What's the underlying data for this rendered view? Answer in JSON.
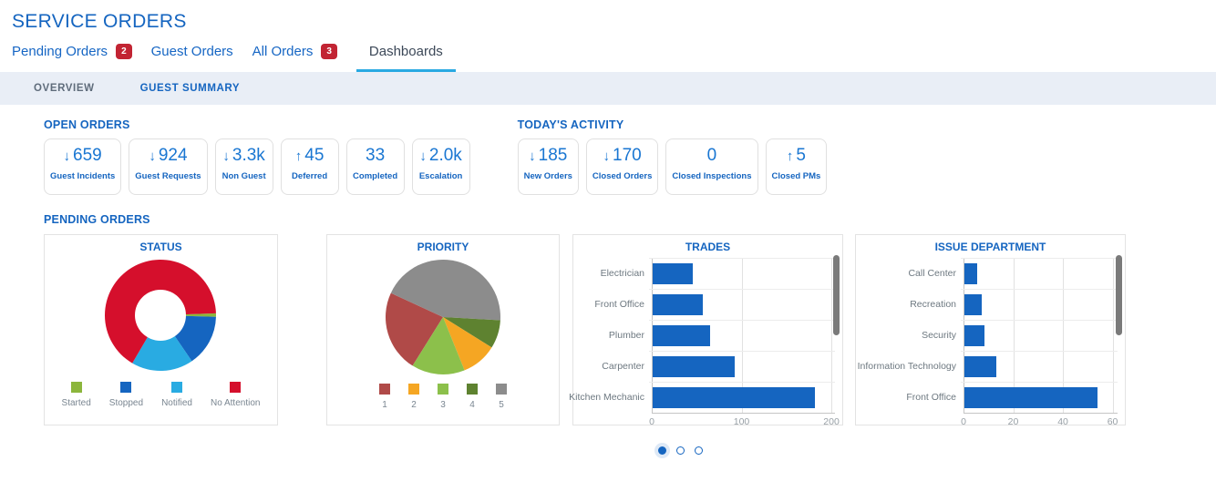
{
  "page": {
    "title": "SERVICE ORDERS"
  },
  "tabs": [
    {
      "label": "Pending Orders",
      "badge": "2",
      "active": false
    },
    {
      "label": "Guest Orders",
      "badge": null,
      "active": false
    },
    {
      "label": "All Orders",
      "badge": "3",
      "active": false
    },
    {
      "label": "Dashboards",
      "badge": null,
      "active": true
    }
  ],
  "subnav": [
    {
      "label": "OVERVIEW",
      "highlighted": false
    },
    {
      "label": "GUEST SUMMARY",
      "highlighted": true
    }
  ],
  "icons": {
    "down": "↓",
    "up": "↑"
  },
  "sections": {
    "open_orders": {
      "title": "OPEN ORDERS",
      "cards": [
        {
          "value": "659",
          "trend": "down",
          "label": "Guest Incidents"
        },
        {
          "value": "924",
          "trend": "down",
          "label": "Guest Requests"
        },
        {
          "value": "3.3k",
          "trend": "down",
          "label": "Non Guest"
        },
        {
          "value": "45",
          "trend": "up",
          "label": "Deferred"
        },
        {
          "value": "33",
          "trend": null,
          "label": "Completed"
        },
        {
          "value": "2.0k",
          "trend": "down",
          "label": "Escalation"
        }
      ]
    },
    "todays_activity": {
      "title": "TODAY'S ACTIVITY",
      "cards": [
        {
          "value": "185",
          "trend": "down",
          "label": "New Orders"
        },
        {
          "value": "170",
          "trend": "down",
          "label": "Closed Orders"
        },
        {
          "value": "0",
          "trend": null,
          "label": "Closed Inspections"
        },
        {
          "value": "5",
          "trend": "up",
          "label": "Closed PMs"
        }
      ]
    },
    "pending_orders": {
      "title": "PENDING ORDERS"
    }
  },
  "chart_data": [
    {
      "id": "status",
      "type": "donut",
      "title": "STATUS",
      "labels": [
        "Started",
        "Stopped",
        "Notified",
        "No Attention"
      ],
      "values": [
        1,
        15,
        18,
        66
      ],
      "colors": [
        "#8cb63c",
        "#1565c0",
        "#29abe2",
        "#d50f2c"
      ],
      "start_angle": 88,
      "draw_order": [
        0,
        1,
        2,
        3
      ],
      "inner_radius_ratio": 0.46,
      "legend_position": "bottom"
    },
    {
      "id": "priority",
      "type": "pie",
      "title": "PRIORITY",
      "labels": [
        "1",
        "2",
        "3",
        "4",
        "5"
      ],
      "values": [
        23,
        10,
        15,
        8,
        44
      ],
      "colors": [
        "#b04a48",
        "#f5a623",
        "#8cc04b",
        "#5e8230",
        "#8c8c8c"
      ],
      "start_angle": 212,
      "draw_order": [
        0,
        4,
        3,
        1,
        2
      ],
      "legend_position": "bottom"
    },
    {
      "id": "trades",
      "type": "bar",
      "title": "TRADES",
      "orientation": "horizontal",
      "categories": [
        "Electrician",
        "Front Office",
        "Plumber",
        "Carpenter",
        "Kitchen Mechanic"
      ],
      "values": [
        45,
        56,
        64,
        92,
        182
      ],
      "bar_color": "#1565c0",
      "x_ticks": [
        0,
        100,
        200
      ],
      "xlim": [
        0,
        204
      ],
      "grid": true,
      "scrollbar": true
    },
    {
      "id": "issue_department",
      "type": "bar",
      "title": "ISSUE DEPARTMENT",
      "orientation": "horizontal",
      "categories": [
        "Call Center",
        "Recreation",
        "Security",
        "Information Technology",
        "Front Office"
      ],
      "values": [
        5,
        7,
        8,
        13,
        54
      ],
      "bar_color": "#1565c0",
      "x_ticks": [
        0,
        20,
        40,
        60
      ],
      "xlim": [
        0,
        62
      ],
      "grid": true,
      "scrollbar": true
    }
  ],
  "carousel": {
    "dots": 3,
    "active_dot": 0
  },
  "colors": {
    "primary_blue": "#1565c0",
    "value_blue": "#1976d2",
    "badge_red": "#c22433",
    "active_tab_text": "#3c4858",
    "active_tab_underline": "#29a9e2",
    "subnav_bg": "#e9eef6",
    "scrollbar_gray": "#7a7a7a"
  }
}
